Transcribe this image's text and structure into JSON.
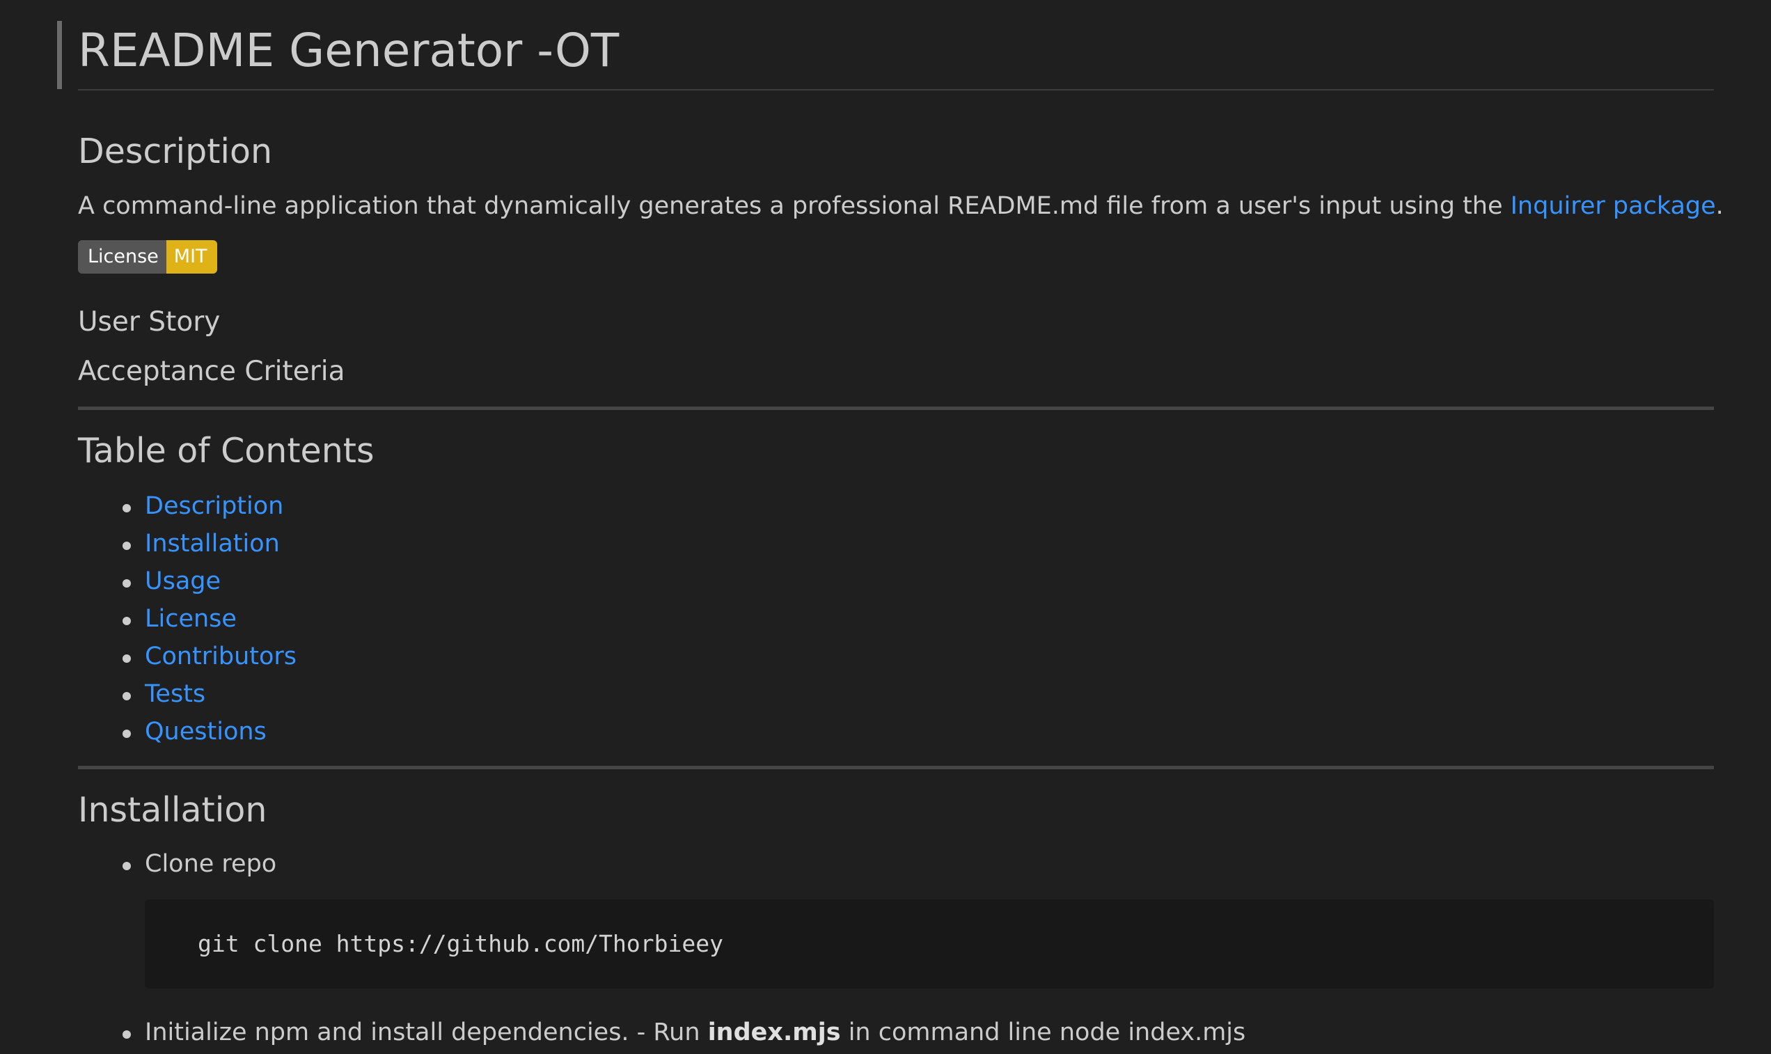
{
  "title": "README Generator -OT",
  "description": {
    "heading": "Description",
    "text_before": "A command-line application that dynamically generates a professional README.md file from a user's input using the ",
    "link_text": "Inquirer package",
    "text_after": "."
  },
  "badge": {
    "label": "License",
    "value": "MIT",
    "label_color": "#555555",
    "value_color": "#dfb317"
  },
  "user_story": "User Story",
  "acceptance_criteria": "Acceptance Criteria",
  "toc": {
    "heading": "Table of Contents",
    "items": [
      "Description",
      "Installation",
      "Usage",
      "License",
      "Contributors",
      "Tests",
      "Questions"
    ]
  },
  "installation": {
    "heading": "Installation",
    "step1": "Clone repo",
    "code": "git clone https://github.com/Thorbieey",
    "step2_before": "Initialize npm and install dependencies. - Run ",
    "step2_bold": "index.mjs",
    "step2_after": " in command line node index.mjs"
  },
  "colors": {
    "background": "#1f1f1f",
    "text": "#cccccc",
    "link": "#3794ff",
    "code_background": "#181818"
  }
}
